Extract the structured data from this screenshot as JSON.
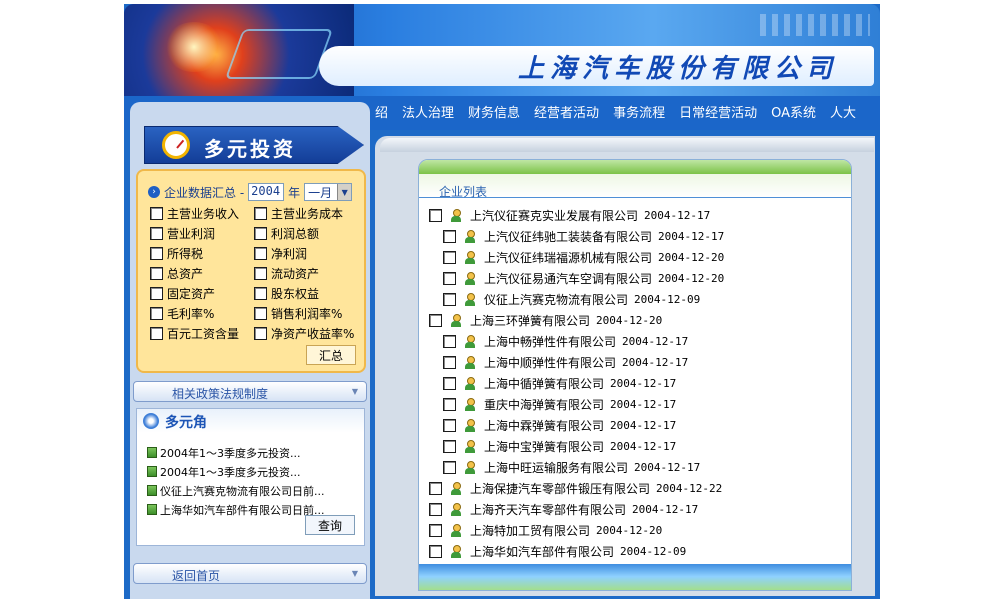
{
  "header": {
    "company_title": "上海汽车股份有限公司"
  },
  "nav": {
    "items": [
      "绍",
      "法人治理",
      "财务信息",
      "经营者活动",
      "事务流程",
      "日常经营活动",
      "OA系统",
      "人大"
    ]
  },
  "sidebar": {
    "section_title": "多元投资",
    "summary": {
      "label": "企业数据汇总 -",
      "year_value": "2004",
      "year_suffix": "年",
      "month_value": "一月",
      "checkboxes": [
        "主营业务收入",
        "主营业务成本",
        "营业利润",
        "利润总额",
        "所得税",
        "净利润",
        "总资产",
        "流动资产",
        "固定资产",
        "股东权益",
        "毛利率%",
        "销售利润率%",
        "百元工资含量",
        "净资产收益率%"
      ],
      "button_label": "汇总"
    },
    "policy_bar_label": "相关政策法规制度",
    "multi_angle": {
      "title": "多元角",
      "items": [
        "2004年1～3季度多元投资...",
        "2004年1～3季度多元投资...",
        "仪征上汽赛克物流有限公司日前...",
        "上海华如汽车部件有限公司日前..."
      ],
      "query_button": "查询"
    },
    "home_bar_label": "返回首页"
  },
  "main": {
    "list_title": "企业列表",
    "rows": [
      {
        "name": "上汽仪征赛克实业发展有限公司",
        "date": "2004-12-17",
        "indent": 0
      },
      {
        "name": "上汽仪征纬驰工装装备有限公司",
        "date": "2004-12-17",
        "indent": 1
      },
      {
        "name": "上汽仪征纬瑞福源机械有限公司",
        "date": "2004-12-20",
        "indent": 1
      },
      {
        "name": "上汽仪征易通汽车空调有限公司",
        "date": "2004-12-20",
        "indent": 1
      },
      {
        "name": "仪征上汽赛克物流有限公司",
        "date": "2004-12-09",
        "indent": 1
      },
      {
        "name": "上海三环弹簧有限公司",
        "date": "2004-12-20",
        "indent": 0
      },
      {
        "name": "上海中畅弹性件有限公司",
        "date": "2004-12-17",
        "indent": 1
      },
      {
        "name": "上海中顺弹性件有限公司",
        "date": "2004-12-17",
        "indent": 1
      },
      {
        "name": "上海中循弹簧有限公司",
        "date": "2004-12-17",
        "indent": 1
      },
      {
        "name": "重庆中海弹簧有限公司",
        "date": "2004-12-17",
        "indent": 1
      },
      {
        "name": "上海中霖弹簧有限公司",
        "date": "2004-12-17",
        "indent": 1
      },
      {
        "name": "上海中宝弹簧有限公司",
        "date": "2004-12-17",
        "indent": 1
      },
      {
        "name": "上海中旺运输服务有限公司",
        "date": "2004-12-17",
        "indent": 1
      },
      {
        "name": "上海保捷汽车零部件锻压有限公司",
        "date": "2004-12-22",
        "indent": 0
      },
      {
        "name": "上海齐天汽车零部件有限公司",
        "date": "2004-12-17",
        "indent": 0
      },
      {
        "name": "上海特加工贸有限公司",
        "date": "2004-12-20",
        "indent": 0
      },
      {
        "name": "上海华如汽车部件有限公司",
        "date": "2004-12-09",
        "indent": 0
      }
    ]
  }
}
